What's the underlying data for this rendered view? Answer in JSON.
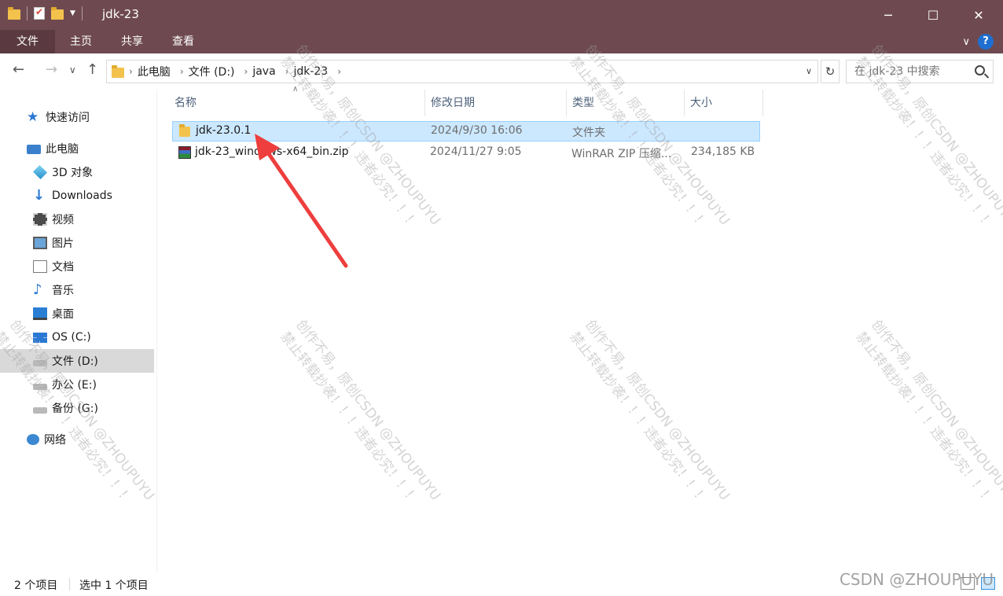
{
  "window": {
    "title": "jdk-23",
    "minimize_label": "─",
    "maximize_label": "☐",
    "close_label": "✕"
  },
  "ribbon": {
    "tabs": [
      "文件",
      "主页",
      "共享",
      "查看"
    ],
    "collapse_label": "∨",
    "help_label": "?"
  },
  "nav": {
    "back_label": "←",
    "forward_label": "→",
    "recent_label": "∨",
    "up_label": "↑",
    "breadcrumb": [
      "此电脑",
      "文件 (D:)",
      "java",
      "jdk-23"
    ],
    "refresh_label": "↻",
    "search_placeholder": "在 jdk-23 中搜索"
  },
  "sidebar": {
    "items": [
      {
        "label": "快速访问",
        "icon": "star-icon"
      },
      {
        "label": "此电脑",
        "icon": "computer-icon"
      },
      {
        "label": "3D 对象",
        "icon": "3d-objects-icon"
      },
      {
        "label": "Downloads",
        "icon": "downloads-icon"
      },
      {
        "label": "视频",
        "icon": "video-icon"
      },
      {
        "label": "图片",
        "icon": "pictures-icon"
      },
      {
        "label": "文档",
        "icon": "documents-icon"
      },
      {
        "label": "音乐",
        "icon": "music-icon"
      },
      {
        "label": "桌面",
        "icon": "desktop-icon"
      },
      {
        "label": "OS (C:)",
        "icon": "windows-drive-icon"
      },
      {
        "label": "文件 (D:)",
        "icon": "drive-icon"
      },
      {
        "label": "办公 (E:)",
        "icon": "drive-icon"
      },
      {
        "label": "备份 (G:)",
        "icon": "drive-icon"
      },
      {
        "label": "网络",
        "icon": "network-icon"
      }
    ],
    "selected": "文件 (D:)"
  },
  "file_list": {
    "columns": [
      "名称",
      "修改日期",
      "类型",
      "大小"
    ],
    "sort_indicator": "∧",
    "rows": [
      {
        "name": "jdk-23.0.1",
        "modified": "2024/9/30 16:06",
        "type": "文件夹",
        "size": "",
        "icon": "folder-icon",
        "selected": true
      },
      {
        "name": "jdk-23_windows-x64_bin.zip",
        "modified": "2024/11/27 9:05",
        "type": "WinRAR ZIP 压缩...",
        "size": "234,185 KB",
        "icon": "winrar-zip-icon",
        "selected": false
      }
    ]
  },
  "status": {
    "item_count": "2 个项目",
    "selection": "选中 1 个项目"
  },
  "watermark": {
    "line1": "创作不易，原创CSDN @ZHOUPUYU",
    "line2": "禁止转载抄袭！！！违者必究！！！",
    "corner": "CSDN @ZHOUPUYU"
  },
  "colors": {
    "titlebar": "#6e4a50",
    "selection": "#cce8ff",
    "annotation_arrow": "#ee3e3e"
  }
}
